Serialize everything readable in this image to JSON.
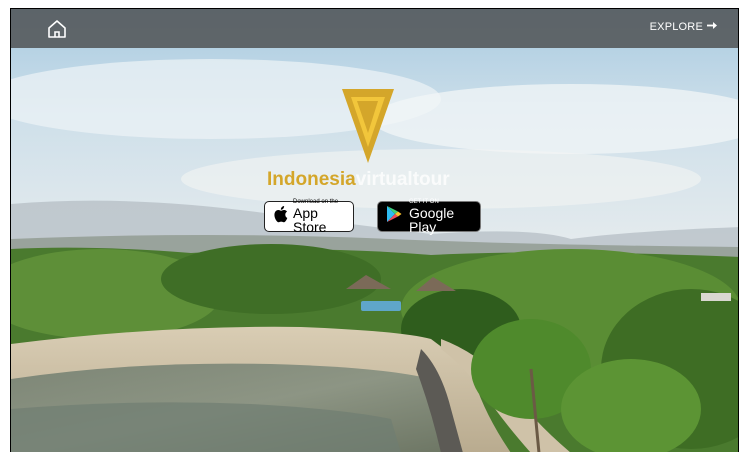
{
  "header": {
    "home_icon": "home-icon",
    "explore_label": "EXPLORE",
    "explore_icon": "arrow-right-icon"
  },
  "brand": {
    "logo_icon": "v-triangle-logo",
    "name_gold": "Indonesia",
    "name_white": "virtualtour",
    "colors": {
      "gold": "#d4a62a",
      "white": "#ffffff"
    }
  },
  "store_badges": {
    "apple": {
      "small": "Download on the",
      "big": "App Store",
      "icon": "apple-icon"
    },
    "google": {
      "small": "GET IT ON",
      "big": "Google Play",
      "icon": "play-store-icon"
    }
  }
}
